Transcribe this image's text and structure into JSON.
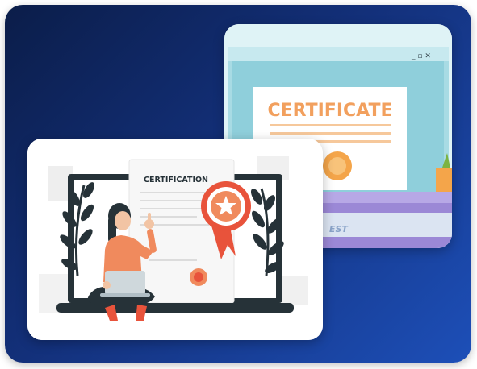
{
  "back_card": {
    "certificate_heading": "CERTIFICATE",
    "window_controls": "_ ▫ ✕",
    "partial_text": "EST"
  },
  "front_card": {
    "certificate_heading": "CERTIFICATION"
  },
  "colors": {
    "background_dark": "#0b1d49",
    "background_light": "#1d4fb8",
    "accent_orange": "#f08a5d",
    "accent_red": "#e8533b",
    "laptop_dark": "#263238",
    "leaf_dark": "#263238",
    "screen_teal": "#9fd6e0",
    "laptop_purple": "#9b88d6"
  }
}
